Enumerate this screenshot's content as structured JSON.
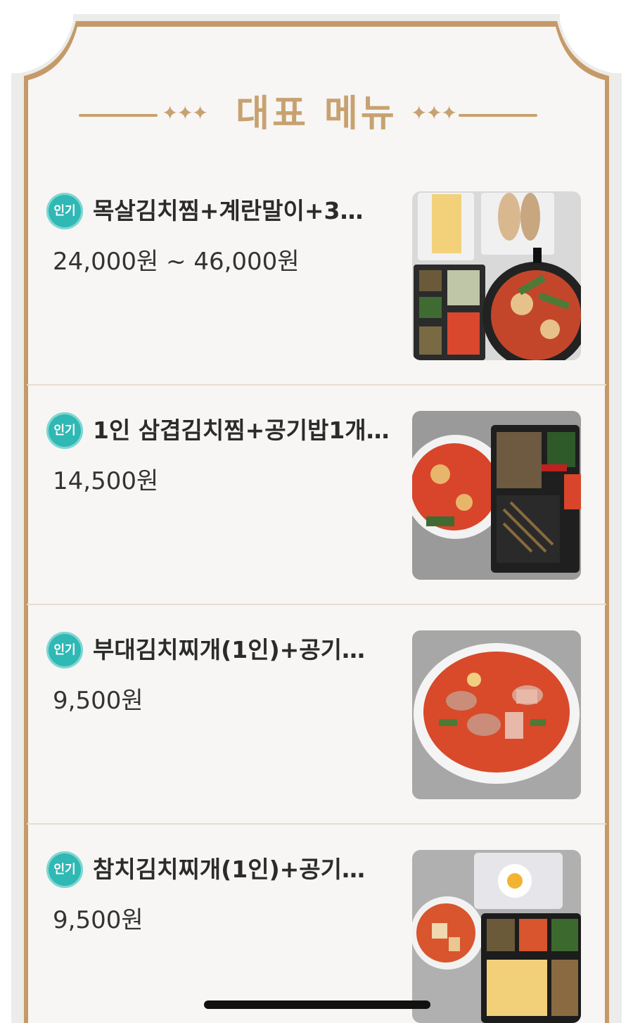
{
  "section": {
    "title": "대표 메뉴"
  },
  "colors": {
    "accent": "#c7a270",
    "badge": "#2fb8b4",
    "card_background": "#f7f6f4",
    "divider": "#e7ddd0"
  },
  "menu": {
    "items": [
      {
        "badge": "인기",
        "name": "목살김치찜+계란말이+3…",
        "price": "24,000원 ~ 46,000원",
        "photo_icon": "food-photo-icon"
      },
      {
        "badge": "인기",
        "name": "1인 삼겹김치찜+공기밥1개…",
        "price": "14,500원",
        "photo_icon": "food-photo-icon"
      },
      {
        "badge": "인기",
        "name": "부대김치찌개(1인)+공기…",
        "price": "9,500원",
        "photo_icon": "food-photo-icon"
      },
      {
        "badge": "인기",
        "name": "참치김치찌개(1인)+공기…",
        "price": "9,500원",
        "photo_icon": "food-photo-icon"
      }
    ]
  }
}
